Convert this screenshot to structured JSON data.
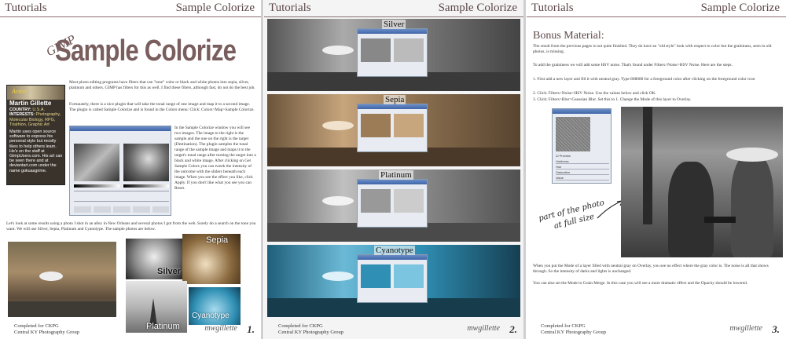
{
  "header": {
    "left": "Tutorials",
    "right": "Sample Colorize"
  },
  "page1": {
    "title_small": "GIMP",
    "title": "Sample Colorize",
    "artist": {
      "badge": "Artist",
      "name": "Martin Gillette",
      "country_label": "COUNTRY:",
      "country": "U.S.A.",
      "interests_label": "INTERESTS:",
      "interests": "Photography, Molecular Biology, RPG, Triathlon, Graphic Art",
      "bio": "Martin uses open source software to express his personal style but mostly likes to help others learn. He's on the staff at GimpUsers.com. His art can be seen there and at deviantart.com under the name gokuasgrime."
    },
    "para1": "Most photo editing programs have filters that can \"tone\" color or black and white photos into sepia, silver, platinum and others. GIMP has filters for this as well. I find these filters, although fast, do not do the best job.",
    "para2": "Fortunately, there is a nice plugin that will take the tonal range of one image and map it to a second image. The plugin is called Sample Colorize and is found in the Colors menu: Click: Colors>Map>Sample Colorize.",
    "para3": "In the Sample Colorize window you will see two images. The image to the right is the sample and the one on the right is the target (Destination). The plugin samples the tonal range of the sample image and maps it to the target's tonal range after turning the target into a black and white image. After clicking on Get Sample Colors you can tweek the intensity of the outcome with the sliders beneath each image. When you see the effect you like, click Apply. If you don't like what you see you can Reset.",
    "para4": "Let's look at some results using a photo I shot in an alley in New Orleans and several photos I got from the web. Surely do a search on the tone you want. We will use Silver, Sepia, Platinum and Cyanotype. The sample photos are below.",
    "labels": {
      "sepia": "Sepia",
      "silver": "Silver",
      "platinum": "Platinum",
      "cyanotype": "Cyanotype"
    }
  },
  "page2": {
    "labels": [
      "Silver",
      "Sepia",
      "Platinum",
      "Cyanotype"
    ]
  },
  "page3": {
    "heading": "Bonus Material:",
    "para1": "The result from the previous pages is not quite finished. They do have an \"old style\" look with respect to color but the graininess, seen in old photos, is missing.",
    "para2": "To add the graininess we will add some HSV noise. That's found under Filters>Noise>HSV Noise. Here are the steps.",
    "step1": "1. First add a new layer and fill it with neutral gray. Type 808080 for a foreground color after clicking on the foreground color icon",
    "step2": "2. Click: Filters>Noise>HSV Noise. Use the values below and click OK.",
    "step3": "3. Click: Filters>Blur>Gaussian Blur. Set this to 1. Change the Mode of this layer to Overlay.",
    "annotation_line1": "part of the photo",
    "annotation_line2": "at full size",
    "para3": "When you put the Mode of a layer filled with neutral gray on Overlay, you see no effect where the gray color is. The noise is all that shows through. So the intensity of darks and lights is unchanged.",
    "para4": "You can also set the Mode to Grain Merge. In this case you will see a more dramatic effect and the Opacity should be lowered.",
    "dlg_rows": [
      "Holdness",
      "Hue",
      "Saturation",
      "Value"
    ],
    "dlg_check": "Preview"
  },
  "footer": {
    "line1": "Completed for CKPG",
    "line2": "Central KY Photography Group",
    "brand": "mwgillette",
    "nums": [
      "1.",
      "2.",
      "3."
    ]
  },
  "colors": {
    "header_text": "#5d4848",
    "title": "#6b4f4f",
    "cyan": "#2f8fb4",
    "sepia": "#a4845a"
  }
}
